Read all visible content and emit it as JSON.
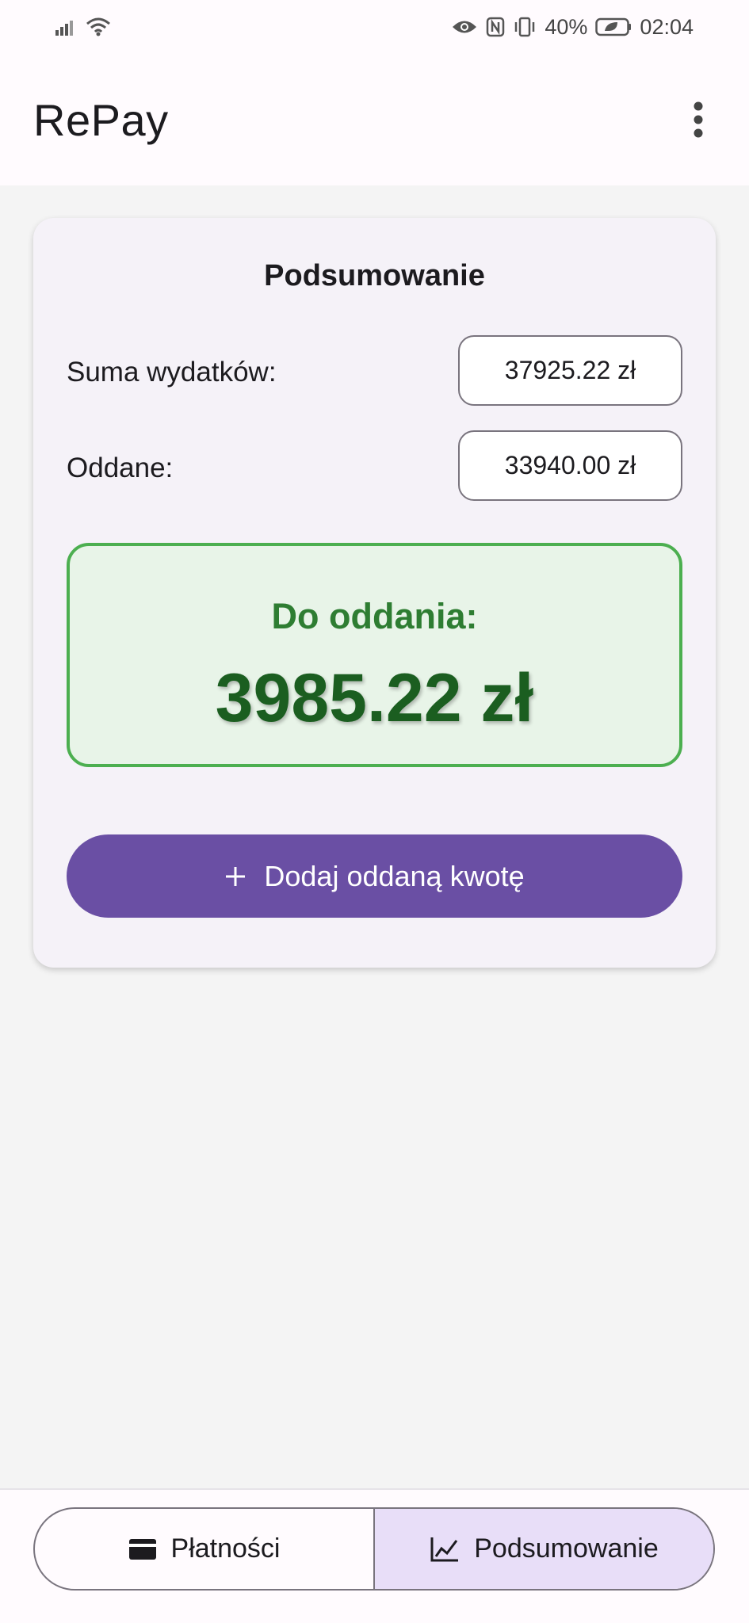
{
  "status_bar": {
    "time": "02:04",
    "battery": "40%",
    "icons": [
      "signal-icon",
      "wifi-icon",
      "eye-icon",
      "nfc-icon",
      "vibrate-icon",
      "battery-icon"
    ]
  },
  "app_bar": {
    "title": "RePay",
    "menu_icon": "more-vert-icon"
  },
  "summary": {
    "title": "Podsumowanie",
    "total_label": "Suma wydatków:",
    "total_value": "37925.22 zł",
    "returned_label": "Oddane:",
    "returned_value": "33940.00 zł",
    "due_label": "Do oddania:",
    "due_value": "3985.22 zł",
    "add_button_label": "Dodaj oddaną kwotę"
  },
  "bottom_nav": {
    "tabs": [
      {
        "label": "Płatności",
        "icon": "payment-card-icon",
        "selected": false
      },
      {
        "label": "Podsumowanie",
        "icon": "chart-line-icon",
        "selected": true
      }
    ]
  },
  "colors": {
    "accent": "#6a4fa4",
    "success_border": "#4caf50",
    "success_bg": "#e8f4e8",
    "success_text": "#2e7d32",
    "selected_tab_bg": "#e8def8"
  }
}
